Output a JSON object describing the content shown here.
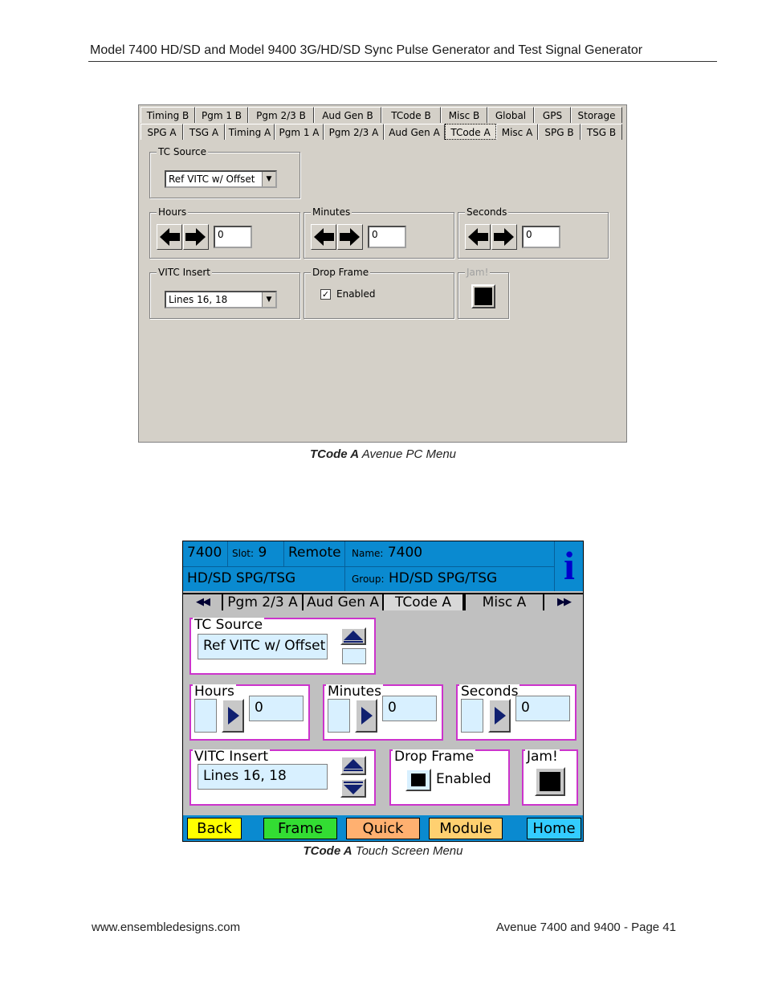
{
  "header": {
    "title": "Model 7400 HD/SD and Model 9400 3G/HD/SD Sync Pulse Generator and Test Signal Generator"
  },
  "pc_menu": {
    "tabs_row1": [
      "Timing B",
      "Pgm 1 B",
      "Pgm 2/3 B",
      "Aud Gen B",
      "TCode B",
      "Misc B",
      "Global",
      "GPS",
      "Storage"
    ],
    "tabs_row2": [
      "SPG A",
      "TSG A",
      "Timing A",
      "Pgm 1 A",
      "Pgm 2/3 A",
      "Aud Gen A",
      "TCode A",
      "Misc A",
      "SPG B",
      "TSG B"
    ],
    "active_tab": "TCode A",
    "tc_source": {
      "label": "TC Source",
      "value": "Ref VITC w/ Offset"
    },
    "hours": {
      "label": "Hours",
      "value": "0"
    },
    "minutes": {
      "label": "Minutes",
      "value": "0"
    },
    "seconds": {
      "label": "Seconds",
      "value": "0"
    },
    "vitc_insert": {
      "label": "VITC Insert",
      "value": "Lines 16, 18"
    },
    "drop_frame": {
      "label": "Drop Frame",
      "checkbox_label": "Enabled",
      "checked": true
    },
    "jam": {
      "label": "Jam!",
      "enabled": false
    }
  },
  "caption_pc": {
    "bold": "TCode A",
    "rest": " Avenue PC Menu"
  },
  "touch_menu": {
    "model": "7400",
    "slot_label": "Slot:",
    "slot_value": "9",
    "mode": "Remote",
    "name_label": "Name:",
    "name_value": "7400",
    "product": "HD/SD SPG/TSG",
    "group_label": "Group:",
    "group_value": "HD/SD SPG/TSG",
    "info_icon": "i",
    "tabs": [
      "Pgm 2/3 A",
      "Aud Gen A",
      "TCode A",
      "Misc A"
    ],
    "prev_arrows": "◀◀",
    "next_arrows": "▶▶",
    "tc_source": {
      "label": "TC Source",
      "value": "Ref VITC w/ Offset"
    },
    "hours": {
      "label": "Hours",
      "value": "0"
    },
    "minutes": {
      "label": "Minutes",
      "value": "0"
    },
    "seconds": {
      "label": "Seconds",
      "value": "0"
    },
    "vitc_insert": {
      "label": "VITC Insert",
      "value": "Lines 16, 18"
    },
    "drop_frame": {
      "label": "Drop Frame",
      "checkbox_label": "Enabled"
    },
    "jam": {
      "label": "Jam!"
    },
    "nav": {
      "back": "Back",
      "frame": "Frame",
      "quick": "Quick",
      "module": "Module",
      "home": "Home"
    },
    "colors": {
      "back": "#ffff00",
      "frame": "#33dd33",
      "quick": "#ffb070",
      "module": "#ffd070",
      "home": "#33ccff",
      "accent": "#0a8ad0",
      "box_border": "#cc33cc"
    }
  },
  "caption_touch": {
    "bold": "TCode A",
    "rest": " Touch Screen Menu"
  },
  "footer": {
    "website": "www.ensembledesigns.com",
    "page": "Avenue 7400 and 9400 - Page 41"
  }
}
